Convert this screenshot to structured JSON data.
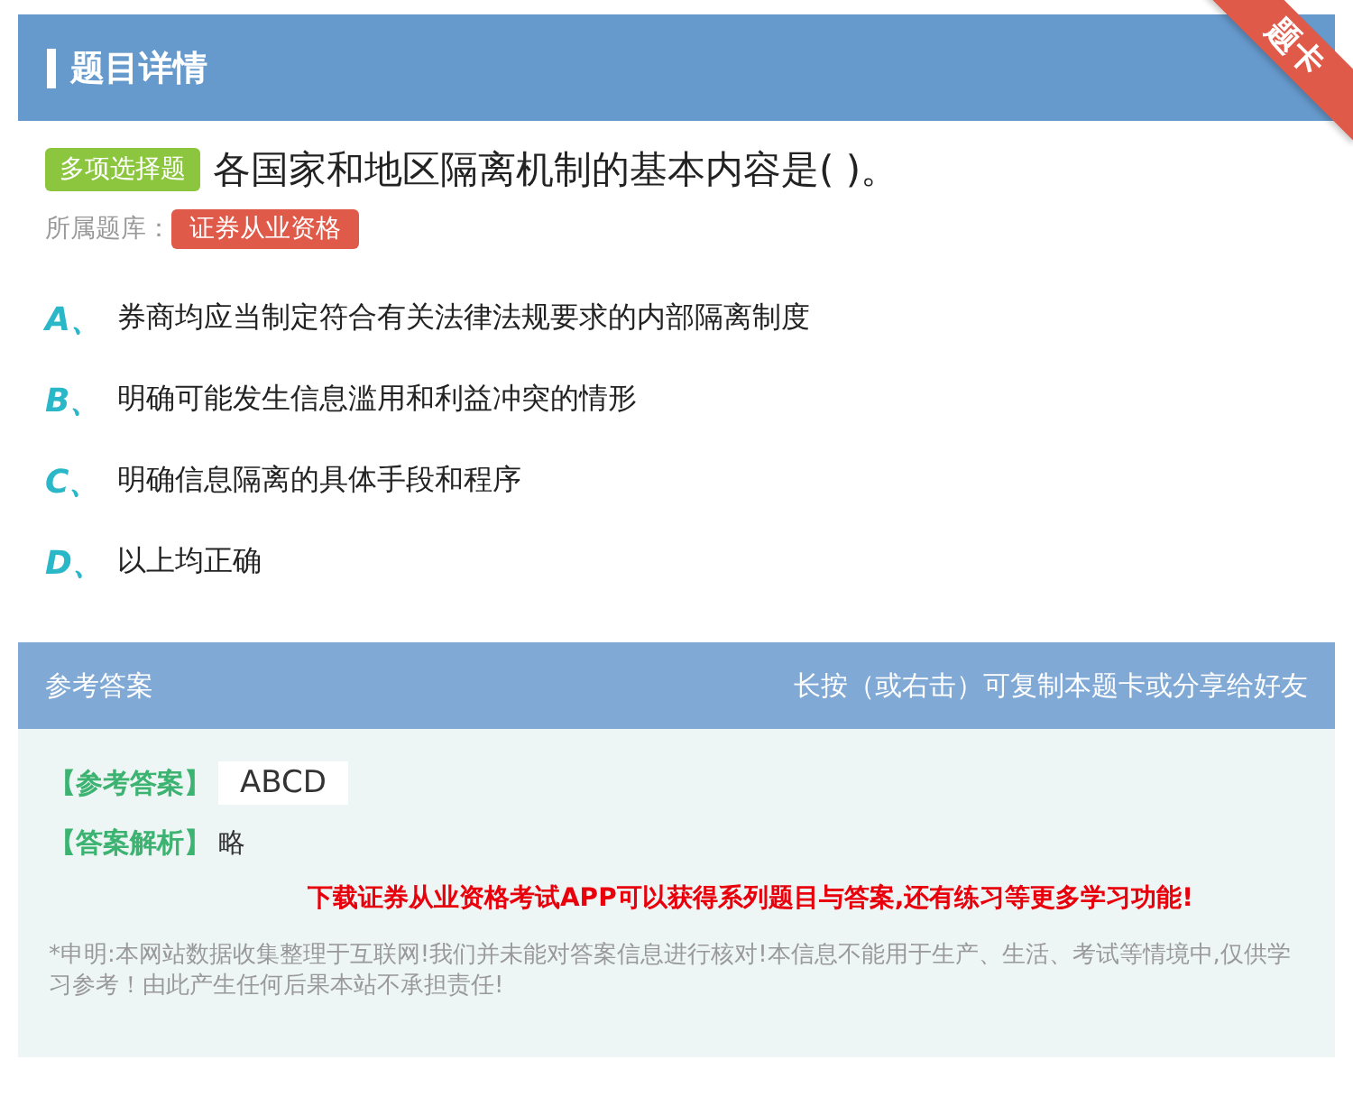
{
  "header": {
    "title": "题目详情",
    "ribbon": "题卡"
  },
  "question": {
    "type_tag": "多项选择题",
    "text": "各国家和地区隔离机制的基本内容是( )。",
    "bank_label": "所属题库：",
    "bank_tag": "证券从业资格"
  },
  "options": [
    {
      "letter": "A、",
      "text": "券商均应当制定符合有关法律法规要求的内部隔离制度"
    },
    {
      "letter": "B、",
      "text": "明确可能发生信息滥用和利益冲突的情形"
    },
    {
      "letter": "C、",
      "text": "明确信息隔离的具体手段和程序"
    },
    {
      "letter": "D、",
      "text": "以上均正确"
    }
  ],
  "answer_panel": {
    "title": "参考答案",
    "hint": "长按（或右击）可复制本题卡或分享给好友",
    "answer_label": "【参考答案】",
    "answer": "ABCD",
    "analysis_label": "【答案解析】",
    "analysis": "略",
    "promo": "下载证券从业资格考试APP可以获得系列题目与答案,还有练习等更多学习功能!",
    "disclaimer": "*申明:本网站数据收集整理于互联网!我们并未能对答案信息进行核对!本信息不能用于生产、生活、考试等情境中,仅供学习参考！由此产生任何后果本站不承担责任!"
  }
}
